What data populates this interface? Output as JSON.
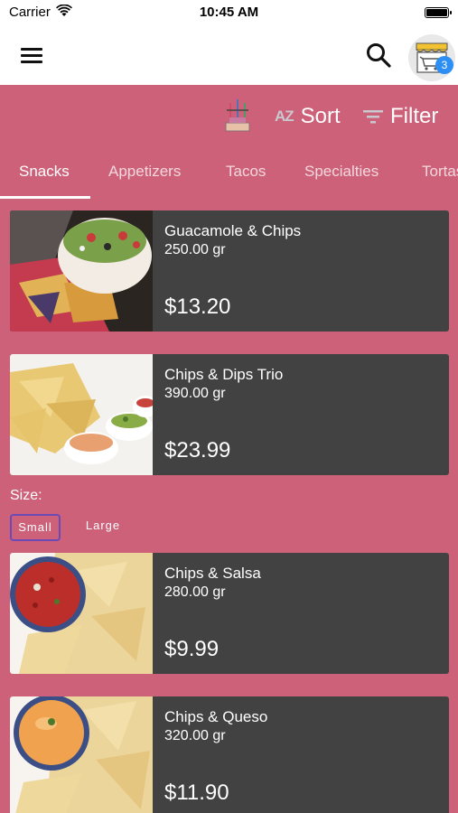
{
  "status_bar": {
    "carrier": "Carrier",
    "time": "10:45 AM"
  },
  "cart": {
    "count": "3"
  },
  "toolbar": {
    "sort_prefix": "AZ",
    "sort_label": "Sort",
    "filter_label": "Filter"
  },
  "tabs": [
    {
      "label": "Snacks",
      "active": true
    },
    {
      "label": "Appetizers"
    },
    {
      "label": "Tacos"
    },
    {
      "label": "Specialties"
    },
    {
      "label": "Tortas"
    }
  ],
  "products": [
    {
      "name": "Guacamole & Chips",
      "weight": "250.00 gr",
      "price": "$13.20"
    },
    {
      "name": "Chips & Dips Trio",
      "weight": "390.00 gr",
      "price": "$23.99"
    },
    {
      "name": "Chips & Salsa",
      "weight": "280.00 gr",
      "price": "$9.99"
    },
    {
      "name": "Chips & Queso",
      "weight": "320.00 gr",
      "price": "$11.90"
    }
  ],
  "size_selector": {
    "label": "Size:",
    "options": [
      "Small",
      "Large"
    ],
    "selected": "Small"
  },
  "colors": {
    "background": "#cd6179",
    "card": "#424242",
    "badge": "#2d8ff3",
    "selected_outline": "#6c4ab6"
  }
}
